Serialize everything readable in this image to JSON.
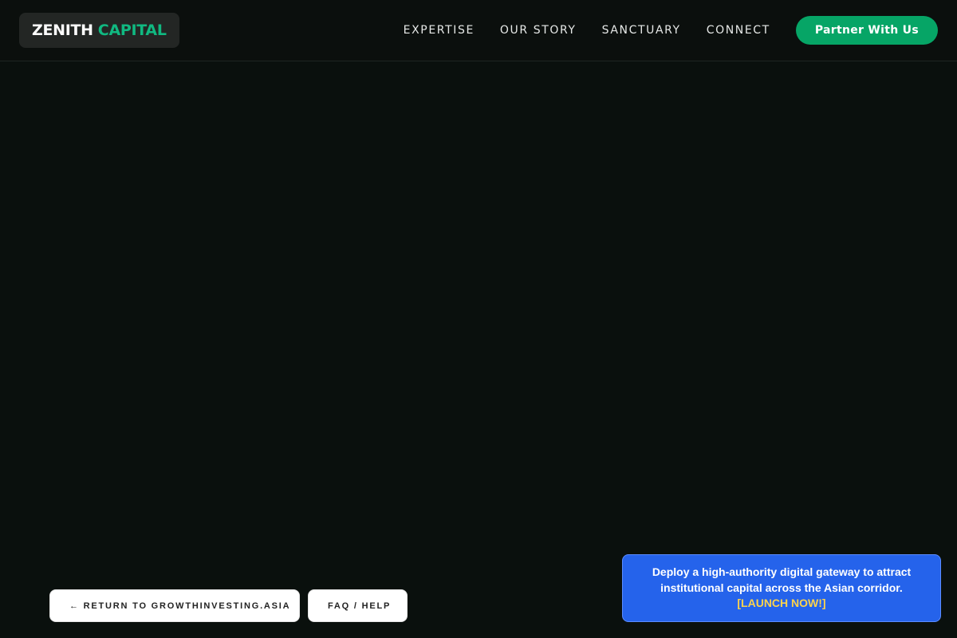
{
  "header": {
    "logo": {
      "first": "ZENITH",
      "second": "CAPITAL"
    },
    "nav": [
      {
        "label": "EXPERTISE"
      },
      {
        "label": "OUR STORY"
      },
      {
        "label": "SANCTUARY"
      },
      {
        "label": "CONNECT"
      }
    ],
    "cta_label": "Partner With Us"
  },
  "footer_buttons": {
    "return_label": "← RETURN TO GROWTHINVESTING.ASIA",
    "faq_label": "FAQ / HELP"
  },
  "promo": {
    "text": "Deploy a high-authority digital gateway to attract institutional capital across the Asian corridor.",
    "link_label": "[LAUNCH NOW!]"
  },
  "colors": {
    "background": "#0a100d",
    "accent_green": "#06a566",
    "promo_blue": "#2563eb",
    "promo_link": "#fcd34d"
  }
}
